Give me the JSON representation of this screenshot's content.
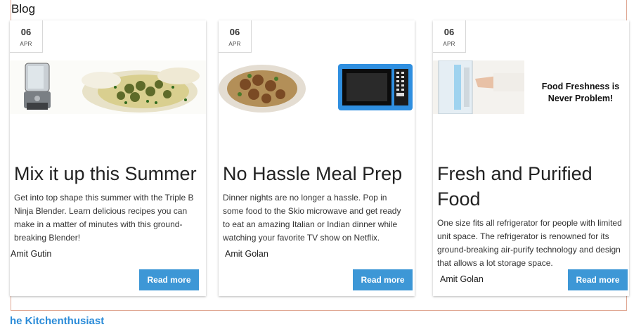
{
  "section": {
    "title": "Blog"
  },
  "posts": [
    {
      "day": "06",
      "month": "APR",
      "title": "Mix it up this Summer",
      "excerpt": "Get into top shape this summer with the Triple B Ninja Blender. Learn delicious recipes you can make in a matter of minutes with this ground-breaking Blender!",
      "author": "Amit Gutin",
      "button": "Read more"
    },
    {
      "day": "06",
      "month": "APR",
      "title": "No Hassle Meal Prep",
      "excerpt": "Dinner nights are no longer a hassle. Pop in some food to the Skio microwave and get ready to  eat an amazing Italian or Indian dinner while watching your favorite TV show on Netflix.",
      "author": "Amit Golan",
      "button": "Read more"
    },
    {
      "day": "06",
      "month": "APR",
      "title": "Fresh and Purified Food",
      "excerpt": "One size fits all refrigerator for people with limited unit space. The refrigerator is renowned for its ground-breaking air-purify technology and design that allows a lot storage space.",
      "author": "Amit Golan",
      "button": "Read more",
      "image_text": "Food Freshness is Never Problem!"
    }
  ],
  "footer": {
    "link": "he Kitchenthusiast"
  },
  "colors": {
    "accent": "#3d97d6",
    "frame": "#e0a894"
  }
}
